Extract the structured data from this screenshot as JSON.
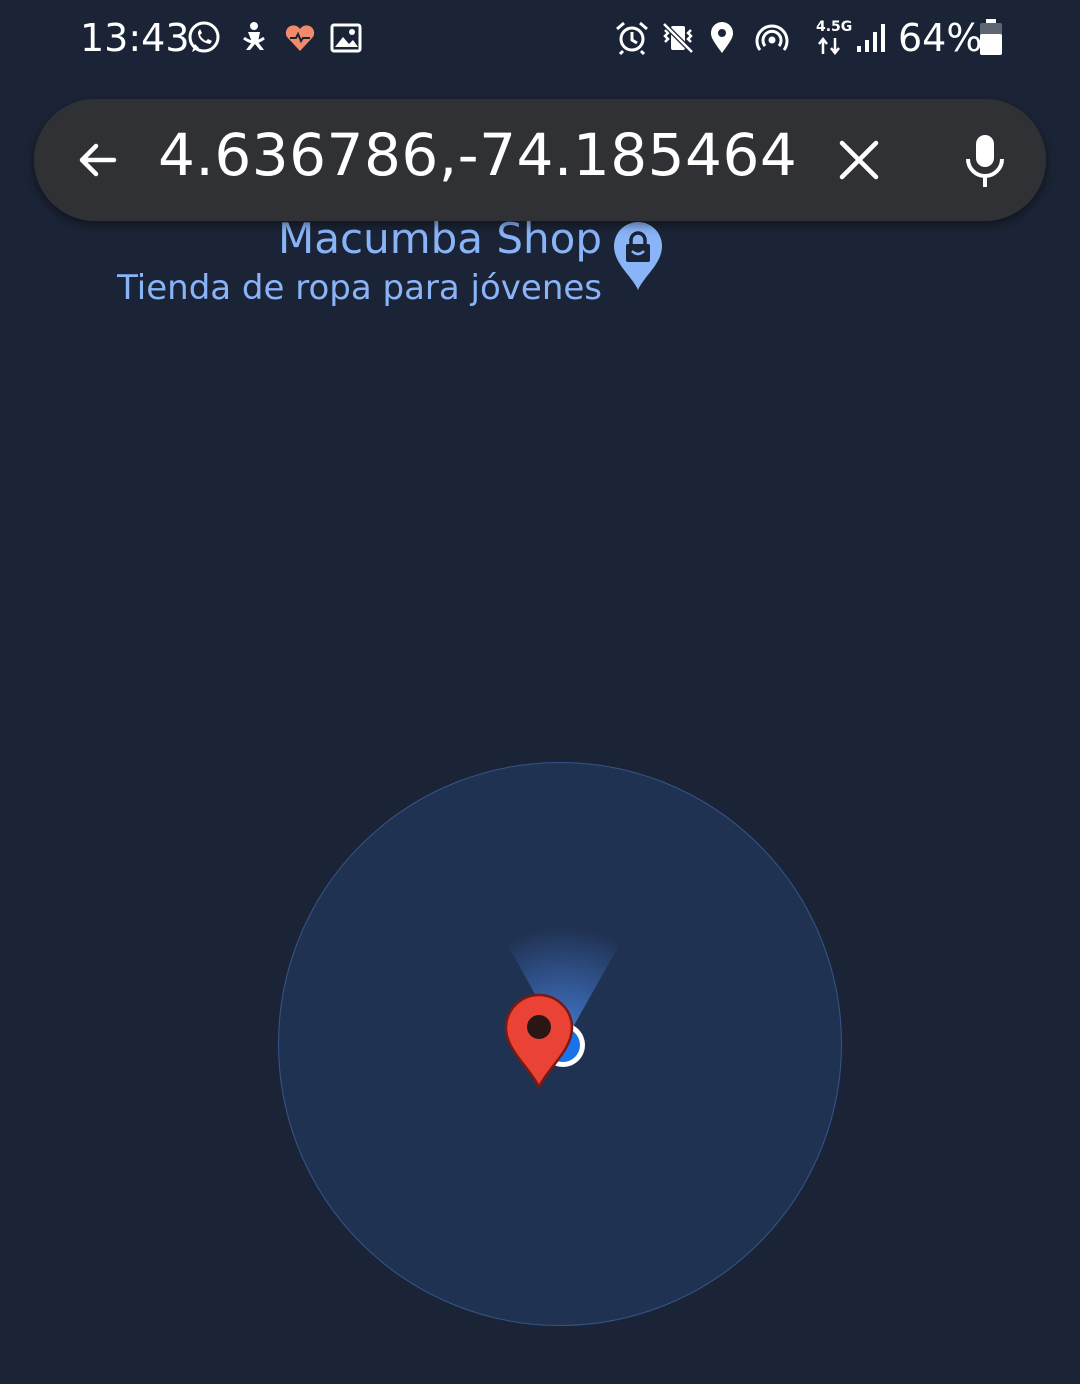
{
  "status_bar": {
    "time": "13:43",
    "battery_percent": "64%",
    "network_type": "4.5G",
    "left_icons": [
      "whatsapp-icon",
      "accessibility-icon",
      "health-heart-icon",
      "gallery-image-icon"
    ],
    "right_icons": [
      "alarm-icon",
      "vibrate-icon",
      "location-icon",
      "hotspot-icon",
      "network-4-5g-icon",
      "signal-icon",
      "battery-icon"
    ]
  },
  "search": {
    "query": "4.636786,-74.185464",
    "back_icon": "arrow-back-icon",
    "clear_icon": "close-icon",
    "mic_icon": "microphone-icon"
  },
  "map": {
    "place": {
      "name": "Macumba Shop",
      "category": "Tienda de ropa para jóvenes",
      "icon": "shopping-bag-marker-icon"
    },
    "pin_icon": "red-location-pin-icon",
    "my_location_icon": "blue-location-dot-icon"
  },
  "colors": {
    "background": "#1b2436",
    "search_bar": "#303134",
    "place_label": "#8ab4f8",
    "accuracy_fill": "#203252",
    "pin_red": "#ea4335",
    "heart": "#f28b6b"
  }
}
